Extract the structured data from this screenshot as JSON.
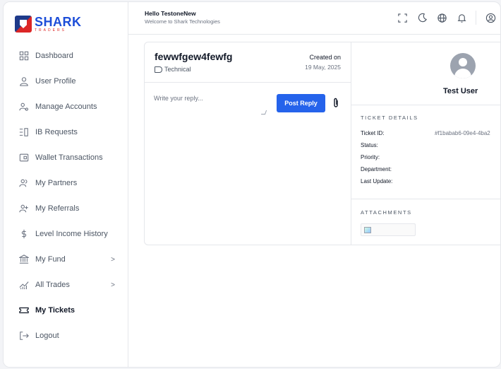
{
  "brand": {
    "name": "SHARK",
    "sub": "TRADERS",
    "tagline": "Shark Technologies"
  },
  "header": {
    "hello": "Hello TestoneNew",
    "welcome": "Welcome to Shark Technologies",
    "icons": [
      "fullscreen-icon",
      "moon-icon",
      "globe-icon",
      "bell-icon",
      "user-icon"
    ]
  },
  "sidebar": {
    "items": [
      {
        "label": "Dashboard",
        "icon": "grid-icon"
      },
      {
        "label": "User Profile",
        "icon": "user-icon"
      },
      {
        "label": "Manage Accounts",
        "icon": "accounts-icon"
      },
      {
        "label": "IB Requests",
        "icon": "list-icon"
      },
      {
        "label": "Wallet Transactions",
        "icon": "wallet-icon"
      },
      {
        "label": "My Partners",
        "icon": "partners-icon"
      },
      {
        "label": "My Referrals",
        "icon": "user-plus-icon"
      },
      {
        "label": "Level Income History",
        "icon": "dollar-icon"
      },
      {
        "label": "My Fund",
        "icon": "bank-icon",
        "chevron": ">"
      },
      {
        "label": "All Trades",
        "icon": "chart-icon",
        "chevron": ">"
      },
      {
        "label": "My Tickets",
        "icon": "ticket-icon",
        "active": true
      },
      {
        "label": "Logout",
        "icon": "logout-icon"
      }
    ]
  },
  "ticket": {
    "title": "fewwfgew4fewfg",
    "category": "Technical",
    "created_label": "Created on",
    "created_date": "19 May, 2025",
    "reply_placeholder": "Write your reply...",
    "post_label": "Post Reply"
  },
  "user": {
    "name": "Test User"
  },
  "details": {
    "heading": "TICKET DETAILS",
    "rows": [
      {
        "key": "Ticket ID:",
        "value": "#f1babab6-09e4-4ba2"
      },
      {
        "key": "Status:",
        "value": ""
      },
      {
        "key": "Priority:",
        "value": ""
      },
      {
        "key": "Department:",
        "value": ""
      },
      {
        "key": "Last Update:",
        "value": ""
      }
    ]
  },
  "attachments": {
    "heading": "ATTACHMENTS"
  },
  "colors": {
    "accent": "#2563eb",
    "brand_blue": "#1d4ed8",
    "brand_red": "#dc2626"
  }
}
